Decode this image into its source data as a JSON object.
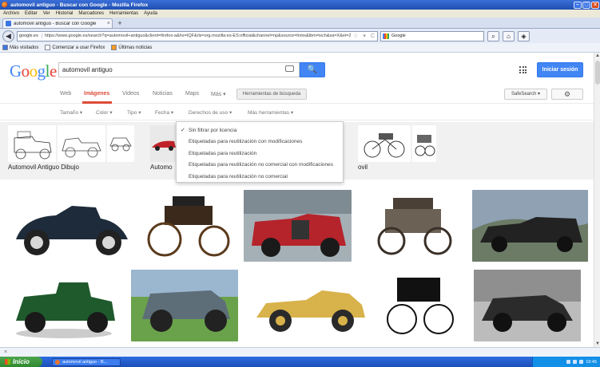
{
  "window": {
    "title": "automovil antiguo - Buscar con Google - Mozilla Firefox",
    "minimize": "–",
    "maximize": "□",
    "close": "✕"
  },
  "menubar": [
    "Archivo",
    "Editar",
    "Ver",
    "Historial",
    "Marcadores",
    "Herramientas",
    "Ayuda"
  ],
  "tabs": [
    {
      "label": "automovil antiguo - Buscar con Google",
      "close": "×"
    }
  ],
  "new_tab_label": "+",
  "navbar": {
    "site_chip": "google.es",
    "url": "https://www.google.es/search?q=automovil+antiguo&client=firefox-a&hs=IQF&rls=org.mozilla:es-ES:official&channel=np&source=lnms&tbm=isch&sa=X&ei=26gIVKKHDMr1UKxJgqgH&ved=",
    "search_engine": "Google"
  },
  "bookmarks": [
    "Más visitados",
    "Comenzar a usar Firefox",
    "Últimas noticias"
  ],
  "google": {
    "logo": "Google",
    "logo_colors": [
      "#4285f4",
      "#ea4335",
      "#fbbc05",
      "#4285f4",
      "#34a853",
      "#ea4335"
    ],
    "query": "automovil antiguo",
    "search_icon": "🔍",
    "signin": "Iniciar sesión",
    "nav_tabs": [
      "Web",
      "Imágenes",
      "Videos",
      "Noticias",
      "Maps",
      "Más ▾"
    ],
    "active_tab": "Imágenes",
    "tools_button": "Herramientas de búsqueda",
    "safesearch": "SafeSearch ▾",
    "settings_icon": "⚙",
    "tools_row": [
      "Tamaño ▾",
      "Color ▾",
      "Tipo ▾",
      "Fecha ▾",
      "Derechos de uso ▾",
      "Más herramientas ▾"
    ]
  },
  "related": [
    {
      "label": "Automovil Antiguo Dibujo"
    },
    {
      "label": "Automo"
    },
    {
      "label": "ovil"
    }
  ],
  "dropdown": {
    "items": [
      {
        "label": "Sin filtrar por licencia",
        "checked": true,
        "check": "✓"
      },
      {
        "label": "Etiquetadas para reutilización con modificaciones"
      },
      {
        "label": "Etiquetadas para reutilización"
      },
      {
        "label": "Etiquetadas para reutilización no comercial con modificaciones"
      },
      {
        "label": "Etiquetadas para reutilización no comercial"
      }
    ]
  },
  "statusbar": {
    "close": "×"
  },
  "taskbar": {
    "start": "Inicio",
    "task": "automovil antiguo - B...",
    "clock": "19:45"
  }
}
